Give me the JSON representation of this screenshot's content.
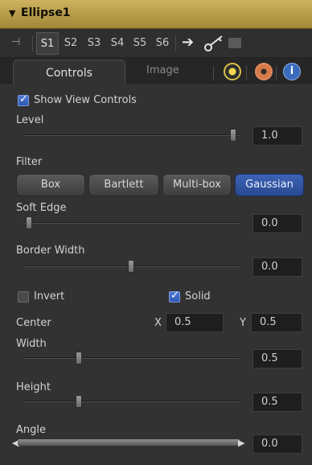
{
  "node": {
    "title": "Ellipse1"
  },
  "toolbar": {
    "slots": [
      "S1",
      "S2",
      "S3",
      "S4",
      "S5",
      "S6"
    ],
    "active_slot": "S1"
  },
  "tabs": {
    "controls": "Controls",
    "image": "Image"
  },
  "show_view_controls": {
    "label": "Show View Controls",
    "checked": true
  },
  "level": {
    "label": "Level",
    "value": "1.0",
    "fraction": 1.0
  },
  "filter": {
    "label": "Filter",
    "options": [
      "Box",
      "Bartlett",
      "Multi-box",
      "Gaussian"
    ],
    "selected": "Gaussian"
  },
  "soft_edge": {
    "label": "Soft Edge",
    "value": "0.0",
    "fraction": 0.0
  },
  "border_width": {
    "label": "Border Width",
    "value": "0.0",
    "fraction": 0.5
  },
  "invert": {
    "label": "Invert",
    "checked": false
  },
  "solid": {
    "label": "Solid",
    "checked": true
  },
  "center": {
    "label": "Center",
    "x_label": "X",
    "x_value": "0.5",
    "y_label": "Y",
    "y_value": "0.5"
  },
  "width": {
    "label": "Width",
    "value": "0.5",
    "fraction": 0.25
  },
  "height": {
    "label": "Height",
    "value": "0.5",
    "fraction": 0.25
  },
  "angle": {
    "label": "Angle",
    "value": "0.0"
  },
  "colors": {
    "title_bar": "#b99d4b",
    "selected_button": "#3357a3",
    "checkbox_on": "#4068c4"
  }
}
